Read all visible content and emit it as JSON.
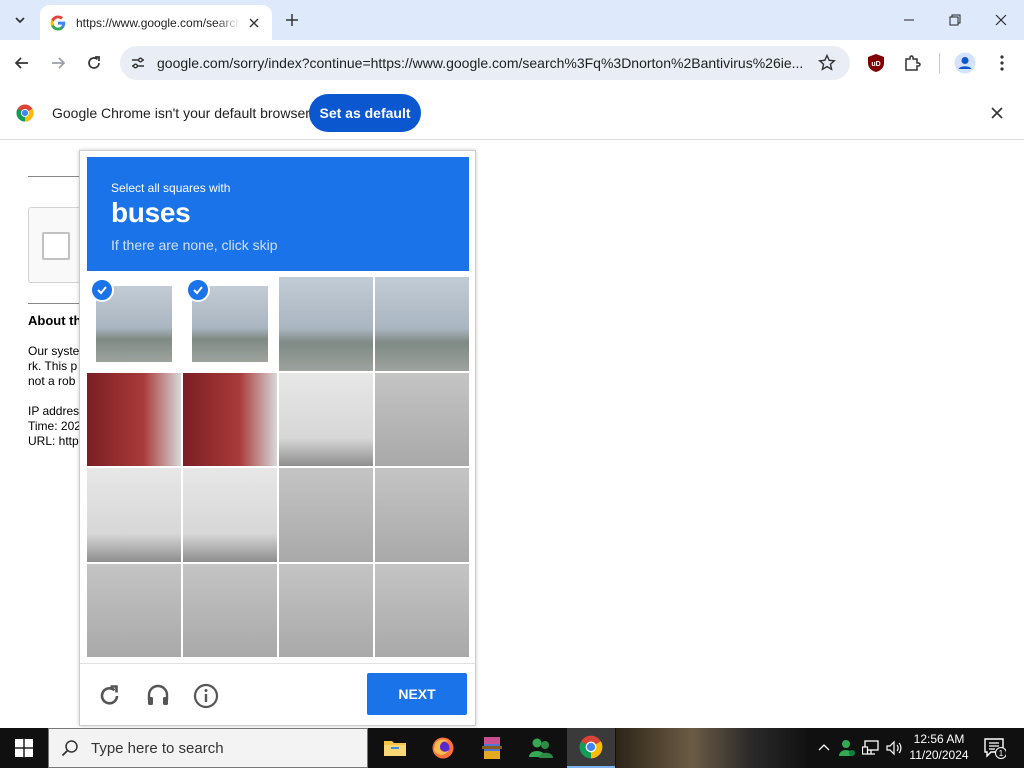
{
  "browser": {
    "tab_title": "https://www.google.com/search",
    "url": "google.com/sorry/index?continue=https://www.google.com/search%3Fq%3Dnorton%2Bantivirus%26ie...",
    "infobar_message": "Google Chrome isn't your default browser",
    "set_default_label": "Set as default"
  },
  "page": {
    "about_heading": "About th",
    "para_lines": [
      "Our syste",
      "rk. This p",
      "not a rob"
    ],
    "info_lines": [
      "IP addres",
      "Time: 202",
      "URL: http"
    ]
  },
  "captcha": {
    "instruction_line1": "Select all squares with",
    "target": "buses",
    "instruction_line3": "If there are none, click skip",
    "next_label": "NEXT",
    "tiles": [
      {
        "scene": "sky",
        "selected": true
      },
      {
        "scene": "sky",
        "selected": true
      },
      {
        "scene": "sky",
        "selected": false
      },
      {
        "scene": "sky",
        "selected": false
      },
      {
        "scene": "busside",
        "selected": false
      },
      {
        "scene": "busside",
        "selected": false
      },
      {
        "scene": "busrear",
        "selected": false
      },
      {
        "scene": "road",
        "selected": false
      },
      {
        "scene": "busrear",
        "selected": false
      },
      {
        "scene": "busrear",
        "selected": false
      },
      {
        "scene": "road",
        "selected": false
      },
      {
        "scene": "road",
        "selected": false
      },
      {
        "scene": "road",
        "selected": false
      },
      {
        "scene": "road",
        "selected": false
      },
      {
        "scene": "road",
        "selected": false
      },
      {
        "scene": "road",
        "selected": false
      }
    ]
  },
  "taskbar": {
    "search_placeholder": "Type here to search",
    "time": "12:56 AM",
    "date": "11/20/2024",
    "notification_count": "1"
  },
  "colors": {
    "captcha_blue": "#1a73e8",
    "chrome_button_blue": "#0b57d0"
  }
}
